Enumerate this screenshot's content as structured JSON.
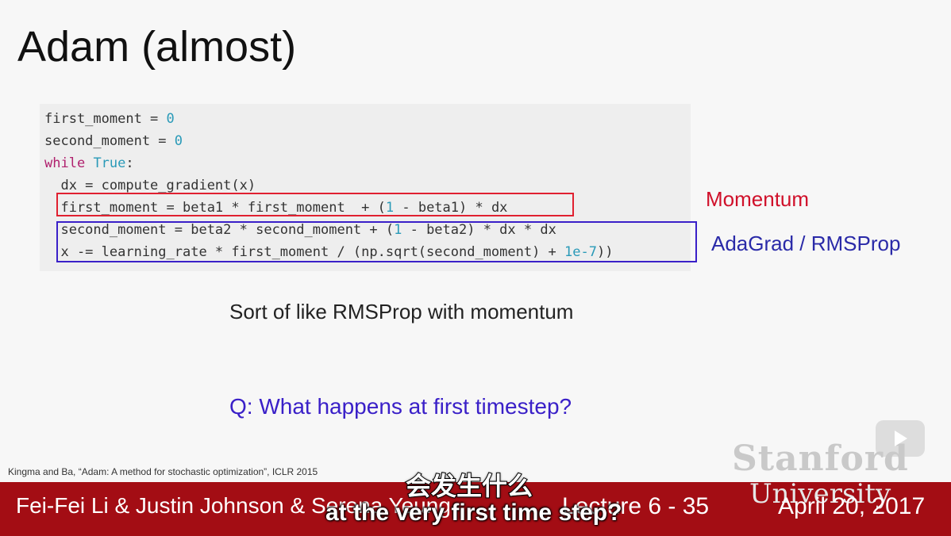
{
  "slide": {
    "title": "Adam (almost)",
    "code": [
      [
        {
          "t": "first_moment = ",
          "c": ""
        },
        {
          "t": "0",
          "c": "num"
        }
      ],
      [
        {
          "t": "second_moment = ",
          "c": ""
        },
        {
          "t": "0",
          "c": "num"
        }
      ],
      [
        {
          "t": "while",
          "c": "kw"
        },
        {
          "t": " ",
          "c": ""
        },
        {
          "t": "True",
          "c": "kw2"
        },
        {
          "t": ":",
          "c": ""
        }
      ],
      [
        {
          "t": "  dx = compute_gradient(x)",
          "c": ""
        }
      ],
      [
        {
          "t": "  first_moment = beta1 * first_moment  + (",
          "c": ""
        },
        {
          "t": "1",
          "c": "num"
        },
        {
          "t": " - beta1) * dx",
          "c": ""
        }
      ],
      [
        {
          "t": "  second_moment = beta2 * second_moment + (",
          "c": ""
        },
        {
          "t": "1",
          "c": "num"
        },
        {
          "t": " - beta2) * dx * dx",
          "c": ""
        }
      ],
      [
        {
          "t": "  x -= learning_rate * first_moment / (np.sqrt(second_moment) + ",
          "c": ""
        },
        {
          "t": "1e-7",
          "c": "num"
        },
        {
          "t": "))",
          "c": ""
        }
      ]
    ],
    "momentum_label": "Momentum",
    "adagrad_label": "AdaGrad / RMSProp",
    "sort_text": "Sort of like RMSProp with momentum",
    "question": "Q: What happens at first timestep?",
    "citation": "Kingma and Ba, “Adam: A method for stochastic optimization”, ICLR 2015",
    "watermark_top": "Stanford",
    "watermark_bottom": "University",
    "colors": {
      "footer": "#a30d14",
      "momentum": "#d0102a",
      "adagrad": "#2a2aa8"
    }
  },
  "footer": {
    "authors": "Fei-Fei Li & Justin Johnson & Serena Yeung",
    "lecture": "Lecture 6 - 35",
    "date": "April 20, 2017"
  },
  "subtitles": {
    "chinese": "会发生什么",
    "english": "at the very first time step?"
  },
  "player": {
    "icon": "play-icon"
  }
}
